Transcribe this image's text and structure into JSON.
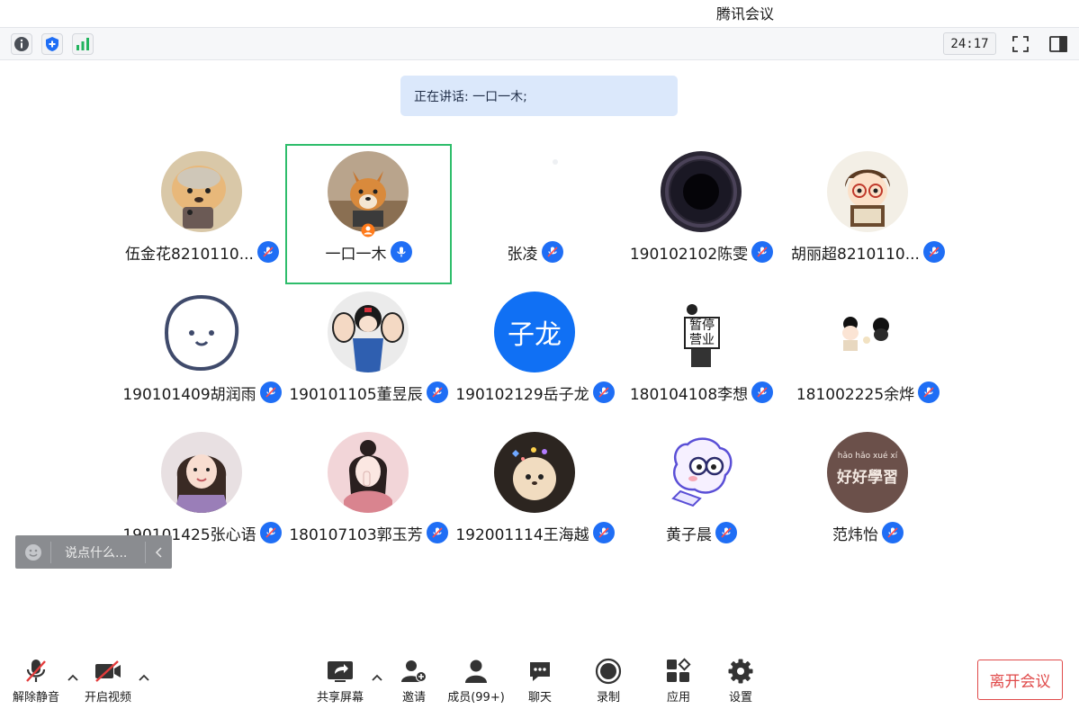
{
  "window": {
    "title": "腾讯会议"
  },
  "infobar": {
    "timer": "24:17"
  },
  "speaking": {
    "text": "正在讲话: 一口一木;"
  },
  "participants": [
    {
      "name": "伍金花8210110..."
    },
    {
      "name": "一口一木"
    },
    {
      "name": "张凌"
    },
    {
      "name": "190102102陈雯"
    },
    {
      "name": "胡丽超8210110..."
    },
    {
      "name": "190101409胡润雨"
    },
    {
      "name": "190101105董昱辰"
    },
    {
      "name": "190102129岳子龙",
      "avatar_text": "子龙"
    },
    {
      "name": "180104108李想",
      "avatar_text_top": "暂停",
      "avatar_text_bottom": "营业"
    },
    {
      "name": "181002225余烨"
    },
    {
      "name": "190101425张心语"
    },
    {
      "name": "180107103郭玉芳"
    },
    {
      "name": "192001114王海越"
    },
    {
      "name": "黄子晨"
    },
    {
      "name": "范炜怡",
      "avatar_text_top": "hǎo hǎo xué xí",
      "avatar_text": "好好學習"
    }
  ],
  "chat": {
    "placeholder": "说点什么..."
  },
  "toolbar": {
    "unmute": "解除静音",
    "video": "开启视频",
    "share": "共享屏幕",
    "invite": "邀请",
    "members": "成员(99+)",
    "chat": "聊天",
    "record": "录制",
    "apps": "应用",
    "settings": "设置",
    "leave": "离开会议"
  },
  "colors": {
    "accent": "#1f6ef5",
    "active_border": "#2ebd6b",
    "leave": "#e04a4a",
    "speaking_bg": "#dbe8fb"
  }
}
